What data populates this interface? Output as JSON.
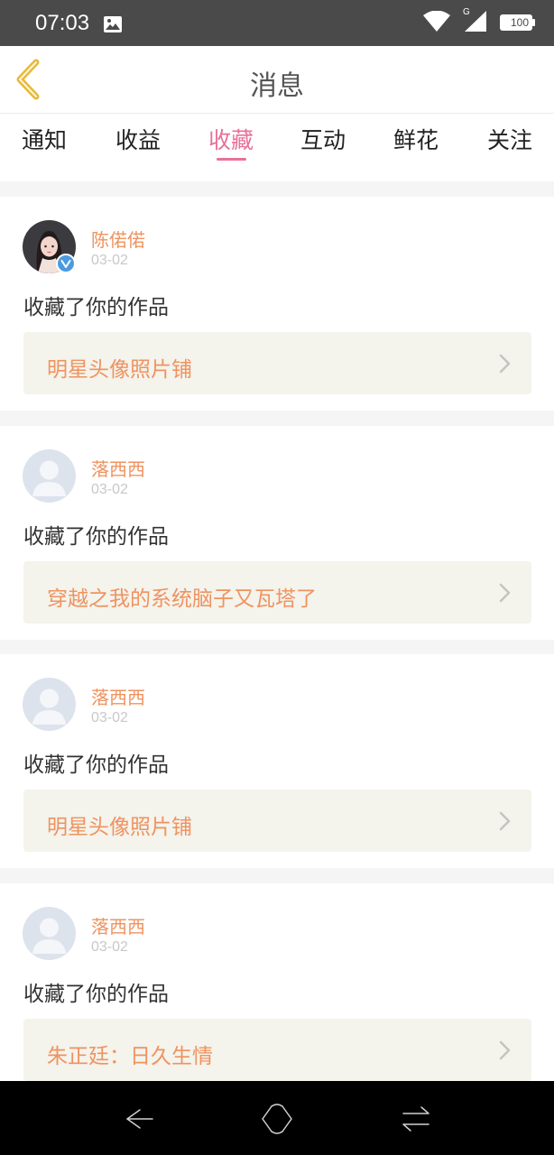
{
  "status_bar": {
    "time": "07:03",
    "network_label": "G",
    "battery": "100",
    "icons": [
      "image-icon",
      "wifi-icon",
      "signal-icon",
      "battery-icon"
    ]
  },
  "header": {
    "title": "消息",
    "back_icon": "chevron-left-icon"
  },
  "tabs": [
    {
      "label": "通知",
      "active": false
    },
    {
      "label": "收益",
      "active": false
    },
    {
      "label": "收藏",
      "active": true
    },
    {
      "label": "互动",
      "active": false
    },
    {
      "label": "鲜花",
      "active": false
    },
    {
      "label": "关注",
      "active": false
    }
  ],
  "messages": [
    {
      "user": "陈偌偌",
      "date": "03-02",
      "action": "收藏了你的作品",
      "work": "明星头像照片铺",
      "avatar": "photo",
      "verified": true
    },
    {
      "user": "落西西",
      "date": "03-02",
      "action": "收藏了你的作品",
      "work": "穿越之我的系统脑子又瓦塔了",
      "avatar": "default",
      "verified": false
    },
    {
      "user": "落西西",
      "date": "03-02",
      "action": "收藏了你的作品",
      "work": "明星头像照片铺",
      "avatar": "default",
      "verified": false
    },
    {
      "user": "落西西",
      "date": "03-02",
      "action": "收藏了你的作品",
      "work": "朱正廷：日久生情",
      "avatar": "default",
      "verified": false
    }
  ],
  "system_nav": {
    "icons": [
      "back-arrow-icon",
      "home-icon",
      "switch-apps-icon"
    ]
  },
  "colors": {
    "accent": "#e8709b",
    "name": "#ef9360",
    "link_bg": "#f4f3ec",
    "status_bar": "#4a4a4a",
    "back_icon": "#e7b83a"
  }
}
